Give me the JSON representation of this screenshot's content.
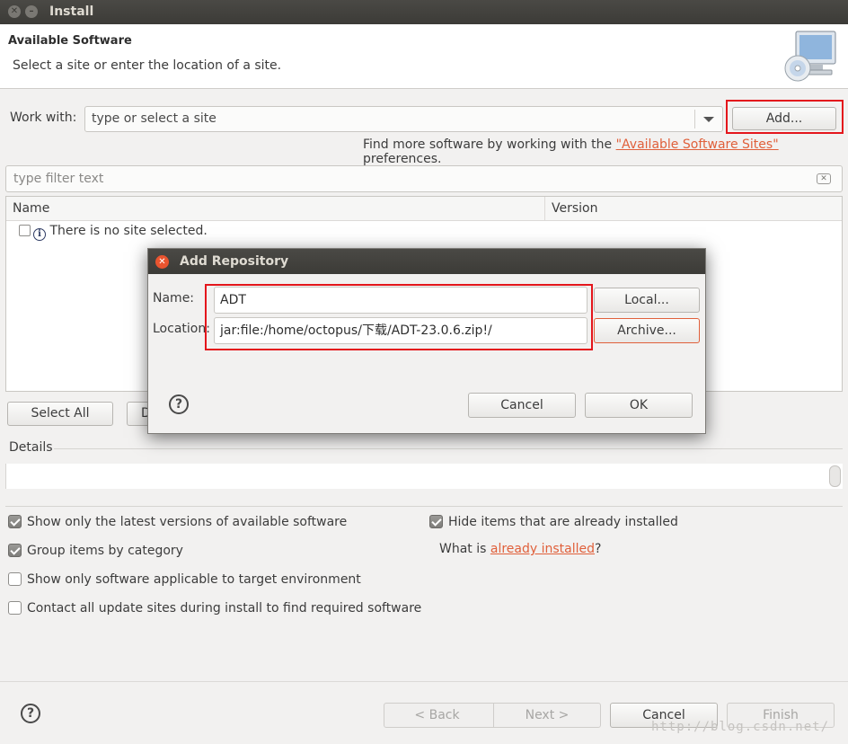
{
  "window": {
    "title": "Install"
  },
  "header": {
    "title": "Available Software",
    "description": "Select a site or enter the location of a site."
  },
  "work_with": {
    "label": "Work with:",
    "combo_placeholder": "type or select a site",
    "add_button": "Add..."
  },
  "find_more": {
    "prefix": "Find more software by working with the ",
    "link": "\"Available Software Sites\"",
    "suffix": " preferences."
  },
  "filter": {
    "placeholder": "type filter text"
  },
  "tree": {
    "columns": [
      "Name",
      "Version"
    ],
    "rows": [
      {
        "text": "There is no site selected."
      }
    ]
  },
  "buttons": {
    "select_all": "Select All",
    "deselect_all_visible": "D"
  },
  "details": {
    "label": "Details"
  },
  "options": {
    "latest_versions": "Show only the latest versions of available software",
    "group_by_category": "Group items by category",
    "target_env": "Show only software applicable to target environment",
    "contact_sites": "Contact all update sites during install to find required software",
    "hide_installed": "Hide items that are already installed",
    "what_is_prefix": "What is ",
    "what_is_link": "already installed",
    "what_is_suffix": "?"
  },
  "footer": {
    "back": "< Back",
    "next": "Next >",
    "cancel": "Cancel",
    "finish": "Finish",
    "watermark": "http://blog.csdn.net/"
  },
  "dialog": {
    "title": "Add Repository",
    "name_label": "Name:",
    "name_value": "ADT",
    "location_label": "Location:",
    "location_value": "jar:file:/home/octopus/下载/ADT-23.0.6.zip!/",
    "local_button": "Local...",
    "archive_button": "Archive...",
    "cancel_button": "Cancel",
    "ok_button": "OK"
  },
  "colors": {
    "link": "#e0603b",
    "highlight": "#e4161c",
    "close": "#e9542f"
  },
  "icons": [
    "close-icon",
    "minimize-icon",
    "monitor-cd-icon",
    "dropdown-arrow-icon",
    "clear-filter-icon",
    "info-icon",
    "help-icon"
  ]
}
